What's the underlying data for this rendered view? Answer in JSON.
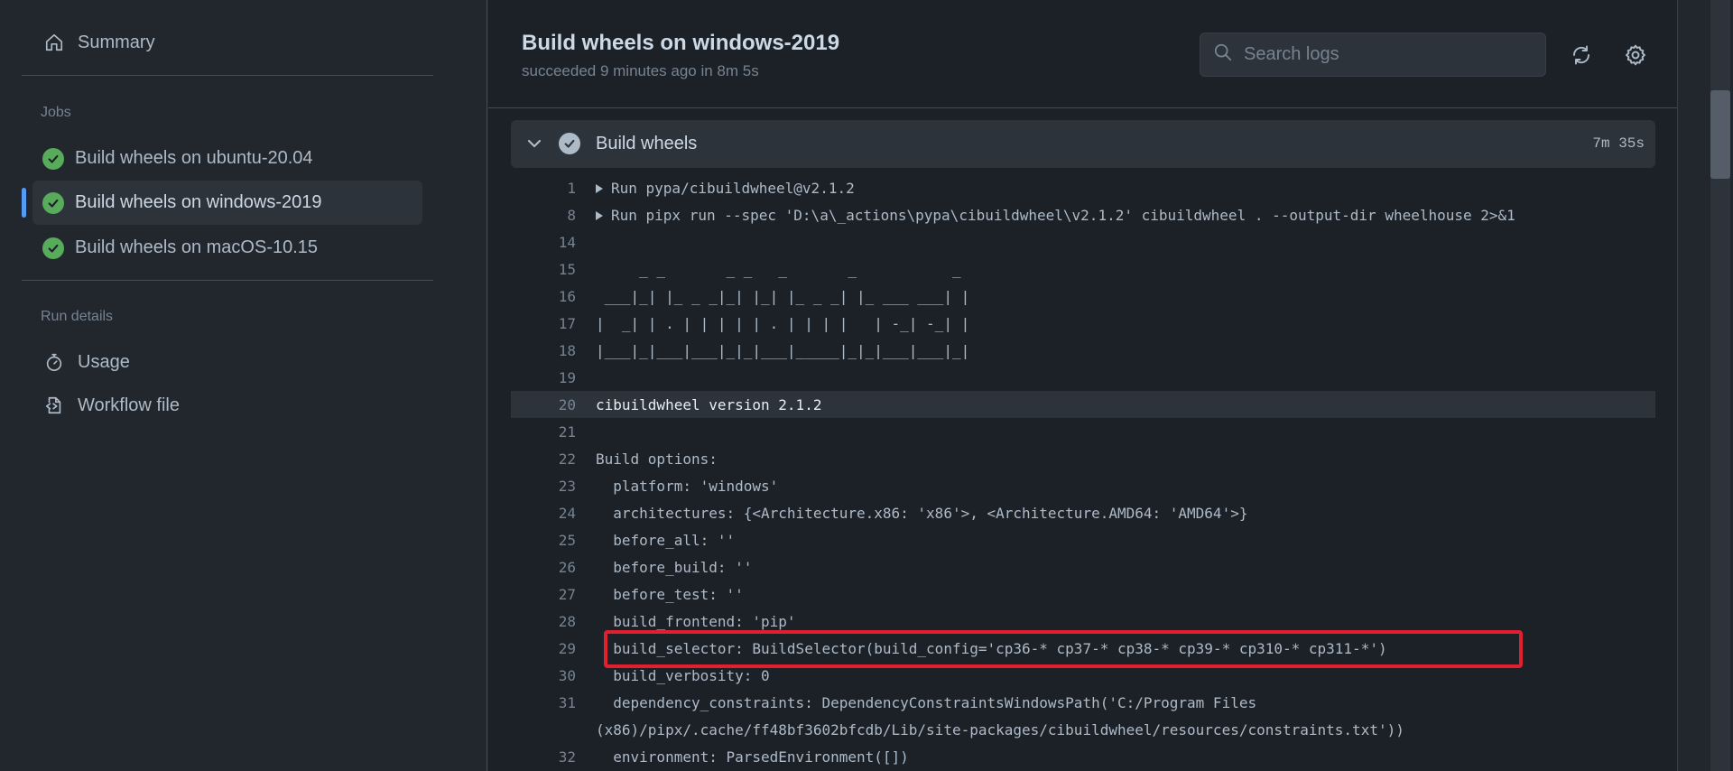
{
  "sidebar": {
    "summary_label": "Summary",
    "jobs_heading": "Jobs",
    "jobs": [
      {
        "label": "Build wheels on ubuntu-20.04"
      },
      {
        "label": "Build wheels on windows-2019"
      },
      {
        "label": "Build wheels on macOS-10.15"
      }
    ],
    "run_details_heading": "Run details",
    "usage_label": "Usage",
    "workflow_label": "Workflow file"
  },
  "header": {
    "title": "Build wheels on windows-2019",
    "subtitle": "succeeded 9 minutes ago in 8m 5s",
    "search_placeholder": "Search logs"
  },
  "step": {
    "name": "Build wheels",
    "duration": "7m 35s"
  },
  "log_lines": [
    {
      "num": "1",
      "text": "Run pypa/cibuildwheel@v2.1.2",
      "group": true
    },
    {
      "num": "8",
      "text": "Run pipx run --spec 'D:\\a\\_actions\\pypa\\cibuildwheel\\v2.1.2' cibuildwheel . --output-dir wheelhouse 2>&1",
      "group": true
    },
    {
      "num": "14",
      "text": ""
    },
    {
      "num": "15",
      "text": "     _ _       _ _   _       _           _"
    },
    {
      "num": "16",
      "text": " ___|_| |_ _ _|_| |_| |_ _ _| |_ ___ ___| |"
    },
    {
      "num": "17",
      "text": "|  _| | . | | | | | . | | | |   | -_| -_| |"
    },
    {
      "num": "18",
      "text": "|___|_|___|___|_|_|___|_____|_|_|___|___|_|"
    },
    {
      "num": "19",
      "text": ""
    },
    {
      "num": "20",
      "text": "cibuildwheel version 2.1.2",
      "highlight": true
    },
    {
      "num": "21",
      "text": ""
    },
    {
      "num": "22",
      "text": "Build options:"
    },
    {
      "num": "23",
      "text": "  platform: 'windows'"
    },
    {
      "num": "24",
      "text": "  architectures: {<Architecture.x86: 'x86'>, <Architecture.AMD64: 'AMD64'>}"
    },
    {
      "num": "25",
      "text": "  before_all: ''"
    },
    {
      "num": "26",
      "text": "  before_build: ''"
    },
    {
      "num": "27",
      "text": "  before_test: ''"
    },
    {
      "num": "28",
      "text": "  build_frontend: 'pip'"
    },
    {
      "num": "29",
      "text": "  build_selector: BuildSelector(build_config='cp36-* cp37-* cp38-* cp39-* cp310-* cp311-*')"
    },
    {
      "num": "30",
      "text": "  build_verbosity: 0"
    },
    {
      "num": "31",
      "text": "  dependency_constraints: DependencyConstraintsWindowsPath('C:/Program Files"
    },
    {
      "num": "",
      "text": "(x86)/pipx/.cache/ff48bf3602bfcdb/Lib/site-packages/cibuildwheel/resources/constraints.txt'))",
      "continuation": true
    },
    {
      "num": "32",
      "text": "  environment: ParsedEnvironment([])"
    }
  ],
  "colors": {
    "success": "#57ab5a",
    "accent": "#539bf5",
    "annotation": "#e0202e"
  }
}
